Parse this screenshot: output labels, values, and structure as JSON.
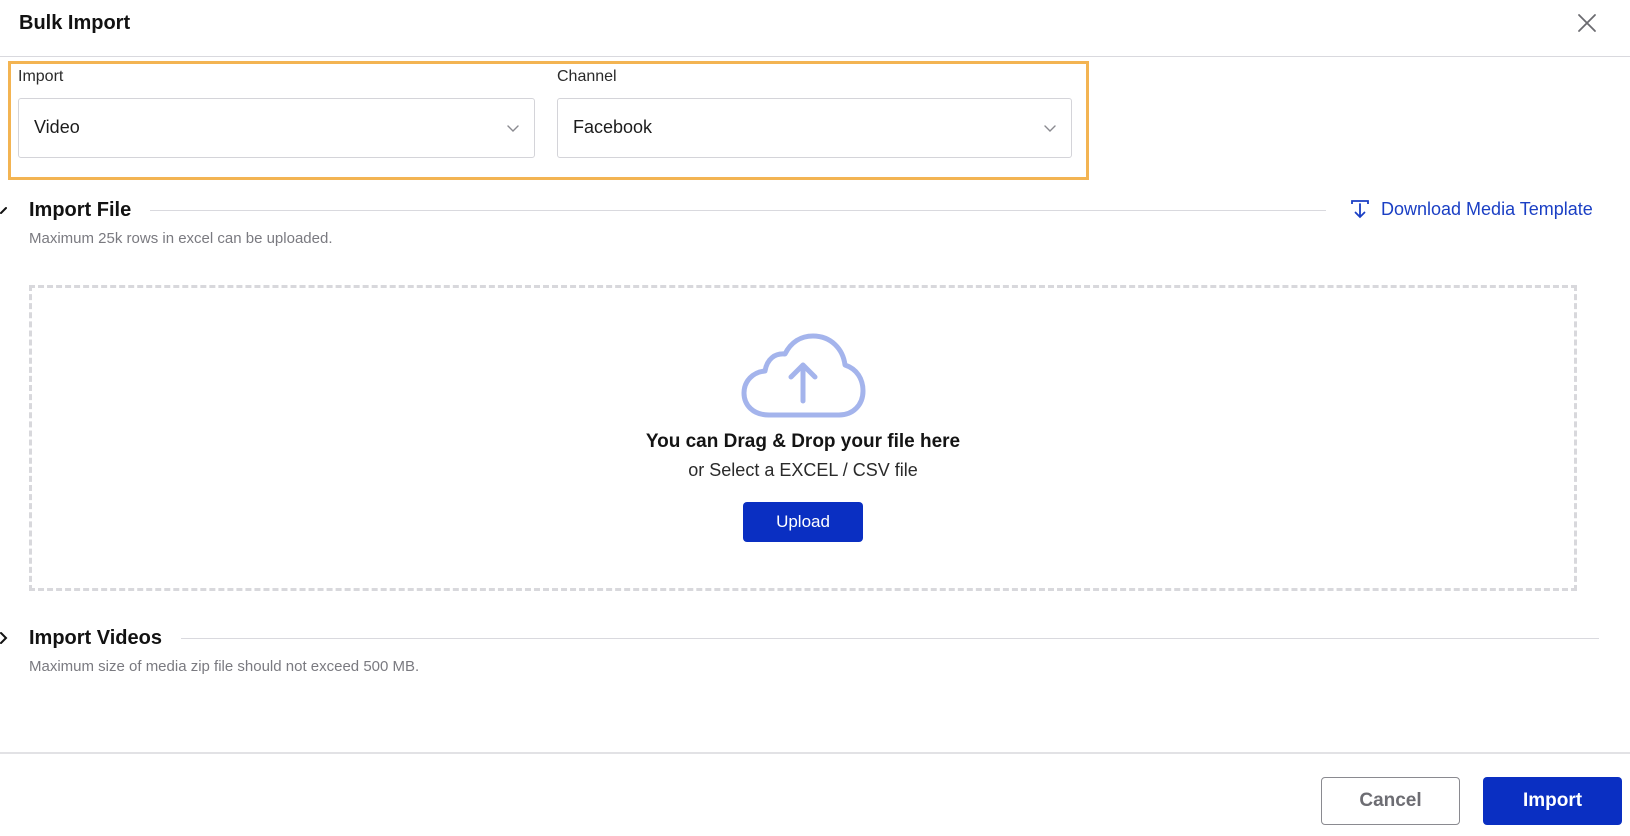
{
  "dialog": {
    "title": "Bulk Import",
    "close_icon": "close-icon"
  },
  "selectors": {
    "import": {
      "label": "Import",
      "value": "Video",
      "icon": "chevron-down-icon"
    },
    "channel": {
      "label": "Channel",
      "value": "Facebook",
      "icon": "chevron-down-icon"
    }
  },
  "import_file": {
    "title": "Import File",
    "subtitle": "Maximum 25k rows in excel can be uploaded.",
    "expanded": true,
    "download_link": {
      "label": "Download Media Template",
      "icon": "download-icon"
    },
    "dropzone": {
      "icon": "cloud-upload-icon",
      "title": "You can Drag & Drop your file here",
      "subtitle": "or Select a EXCEL / CSV file",
      "button_label": "Upload"
    }
  },
  "import_videos": {
    "title": "Import Videos",
    "subtitle": "Maximum size of media zip file should not exceed 500 MB.",
    "expanded": false
  },
  "footer": {
    "cancel_label": "Cancel",
    "import_label": "Import"
  },
  "colors": {
    "primary": "#0a2fc2",
    "link": "#1a3fc4",
    "highlight_border": "#f3b452",
    "cloud_icon": "#a4b4ec"
  }
}
